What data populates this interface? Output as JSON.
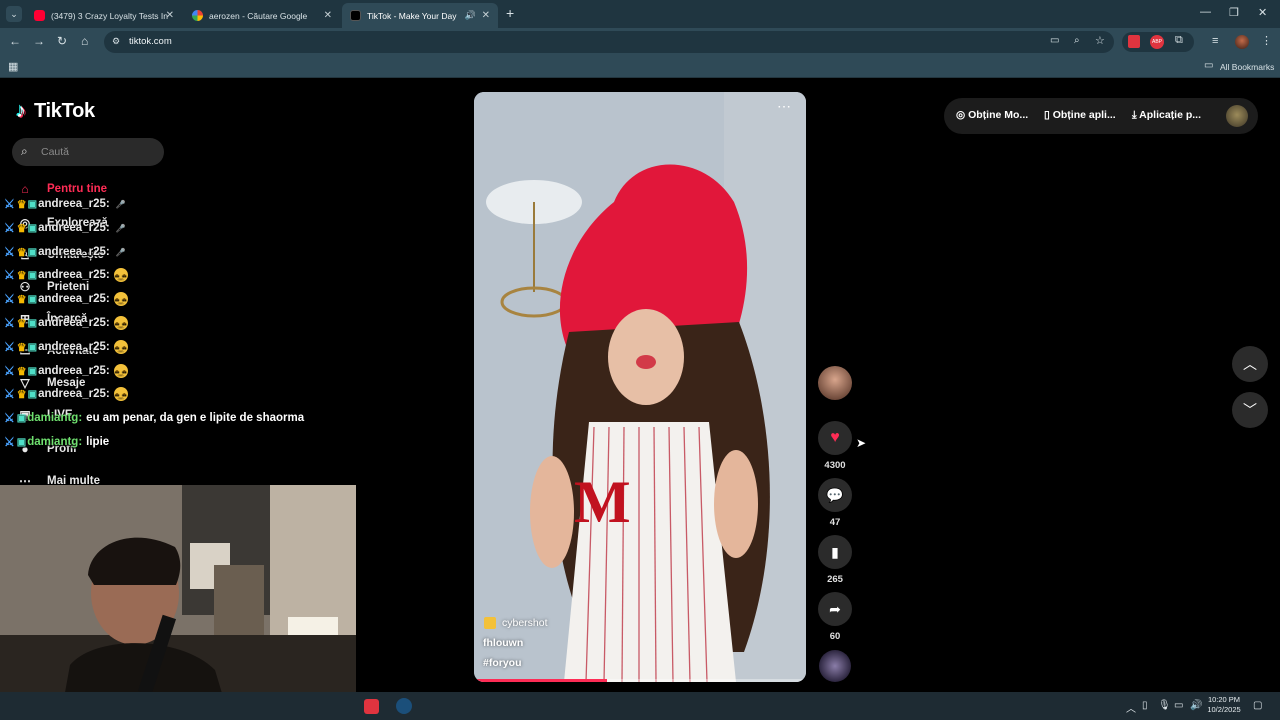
{
  "browser": {
    "tabs": [
      {
        "title": "(3479) 3 Crazy Loyalty Tests In C",
        "favicon": "youtube-icon",
        "color": "#ff0033"
      },
      {
        "title": "aerozen - Căutare Google",
        "favicon": "google-icon",
        "color": "#ffffff"
      },
      {
        "title": "TikTok - Make Your Day",
        "favicon": "tiktok-icon",
        "color": "#000000"
      }
    ],
    "url": "tiktok.com",
    "bookmarks_label": "All Bookmarks"
  },
  "tiktok": {
    "logo": "TikTok",
    "search_placeholder": "Caută",
    "nav": [
      {
        "label": "Pentru tine",
        "icon": "home-icon"
      },
      {
        "label": "Explorează",
        "icon": "compass-icon"
      },
      {
        "label": "Urmărește",
        "icon": "following-icon"
      },
      {
        "label": "Prieteni",
        "icon": "friends-icon"
      },
      {
        "label": "Încarcă",
        "icon": "upload-icon"
      },
      {
        "label": "Activitate",
        "icon": "activity-icon"
      },
      {
        "label": "Mesaje",
        "icon": "messages-icon"
      },
      {
        "label": "LIVE",
        "icon": "live-icon"
      },
      {
        "label": "Profil",
        "icon": "profile-icon"
      },
      {
        "label": "Mai multe",
        "icon": "more-icon"
      }
    ],
    "top_right": {
      "coins": "Obține Mo...",
      "app": "Obține apli...",
      "desktop": "Aplicație p..."
    },
    "video": {
      "sound": "cybershot",
      "author": "fhlouwn",
      "hashtag": "#foryou",
      "progress": 0.4
    },
    "actions": {
      "likes": "4300",
      "comments": "47",
      "saves": "265",
      "shares": "60"
    },
    "accent": "#fe2c55"
  },
  "chat": [
    {
      "user": "andreea_r25:",
      "message": "",
      "emote": "microphone-emote"
    },
    {
      "user": "andreea_r25:",
      "message": "",
      "emote": "microphone-emote"
    },
    {
      "user": "andreea_r25:",
      "message": "",
      "emote": "microphone-emote"
    },
    {
      "user": "andreea_r25:",
      "message": "",
      "emote": "face-emote"
    },
    {
      "user": "andreea_r25:",
      "message": "",
      "emote": "face-emote"
    },
    {
      "user": "andreea_r25:",
      "message": "",
      "emote": "face-emote"
    },
    {
      "user": "andreea_r25:",
      "message": "",
      "emote": "face-emote"
    },
    {
      "user": "andreea_r25:",
      "message": "",
      "emote": "face-emote"
    },
    {
      "user": "andreea_r25:",
      "message": "",
      "emote": "face-emote"
    },
    {
      "user": "damiantg:",
      "message": "eu am penar, da gen e lipite de shaorma",
      "emote": ""
    },
    {
      "user": "damiantg:",
      "message": "lipie",
      "emote": ""
    }
  ],
  "taskbar": {
    "time": "10:20 PM",
    "date": "10/2/2025"
  }
}
